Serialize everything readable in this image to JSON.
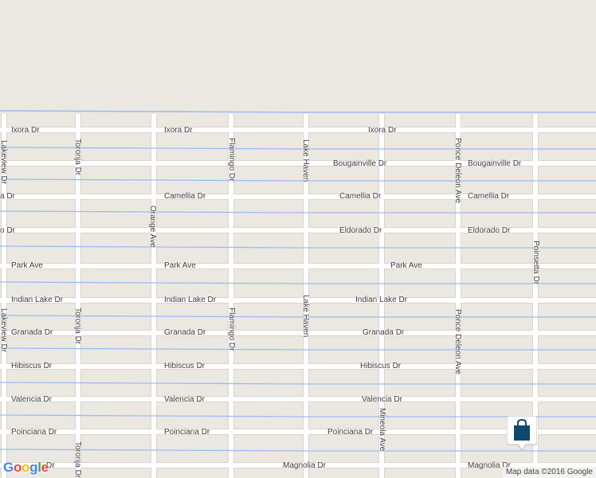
{
  "colors": {
    "background": "#ebe8e1",
    "road": "#ffffff",
    "road_border": "#d8d4cb",
    "water_line": "#9cbcf2",
    "marker": "#0d4a6b"
  },
  "streets": {
    "horizontal": [
      {
        "name": "Ixora Dr",
        "labels": [
          "Ixora Dr",
          "Ixora Dr",
          "Ixora Dr"
        ]
      },
      {
        "name": "Bougainville Dr",
        "labels": [
          "Bougainville Dr",
          "Bougainville Dr"
        ]
      },
      {
        "name": "Camellia Dr",
        "labels": [
          "a Dr",
          "Camellia Dr",
          "Camellia Dr",
          "Camellia Dr"
        ]
      },
      {
        "name": "Eldorado Dr",
        "labels": [
          "o Dr",
          "Eldorado Dr",
          "Eldorado Dr"
        ]
      },
      {
        "name": "Park Ave",
        "labels": [
          "Park Ave",
          "Park Ave",
          "Park Ave"
        ]
      },
      {
        "name": "Indian Lake Dr",
        "labels": [
          "Indian Lake Dr",
          "Indian Lake Dr",
          "Indian Lake Dr"
        ]
      },
      {
        "name": "Granada Dr",
        "labels": [
          "Granada Dr",
          "Granada Dr",
          "Granada Dr"
        ]
      },
      {
        "name": "Hibiscus Dr",
        "labels": [
          "Hibiscus Dr",
          "Hibiscus Dr",
          "Hibiscus Dr"
        ]
      },
      {
        "name": "Valencia Dr",
        "labels": [
          "Valencia Dr",
          "Valencia Dr",
          "Valencia Dr"
        ]
      },
      {
        "name": "Poinciana Dr",
        "labels": [
          "Poinciana Dr",
          "Poinciana Dr",
          "Poinciana Dr"
        ]
      },
      {
        "name": "Magnolia Dr",
        "labels": [
          "Dr",
          "Magnolia Dr",
          "Magnolia Dr"
        ]
      }
    ],
    "vertical": [
      {
        "name": "Lakeview Dr",
        "labels": [
          "Lakeview Dr",
          "Lakeview Dr"
        ]
      },
      {
        "name": "Toronja Dr",
        "labels": [
          "Toronja Dr",
          "Toronja Dr",
          "Toronja Dr"
        ]
      },
      {
        "name": "Orange Ave",
        "labels": [
          "Orange Ave"
        ]
      },
      {
        "name": "Flamingo Dr",
        "labels": [
          "Flamingo Dr",
          "Flamingo Dr"
        ]
      },
      {
        "name": "Lake Haven",
        "labels": [
          "Lake Haven",
          "Lake Haven"
        ]
      },
      {
        "name": "Mineola Ave",
        "labels": [
          "Mineola Ave"
        ]
      },
      {
        "name": "Ponce Deleon Ave",
        "labels": [
          "Ponce Deleon Ave",
          "Ponce Deleon Ave"
        ]
      },
      {
        "name": "Poinsetta Dr",
        "labels": [
          "Poinsetta Dr"
        ]
      }
    ]
  },
  "marker": {
    "icon": "shopping-bag-icon"
  },
  "branding": {
    "logo": [
      "G",
      "o",
      "o",
      "g",
      "l",
      "e"
    ]
  },
  "attribution": "Map data ©2016 Google"
}
